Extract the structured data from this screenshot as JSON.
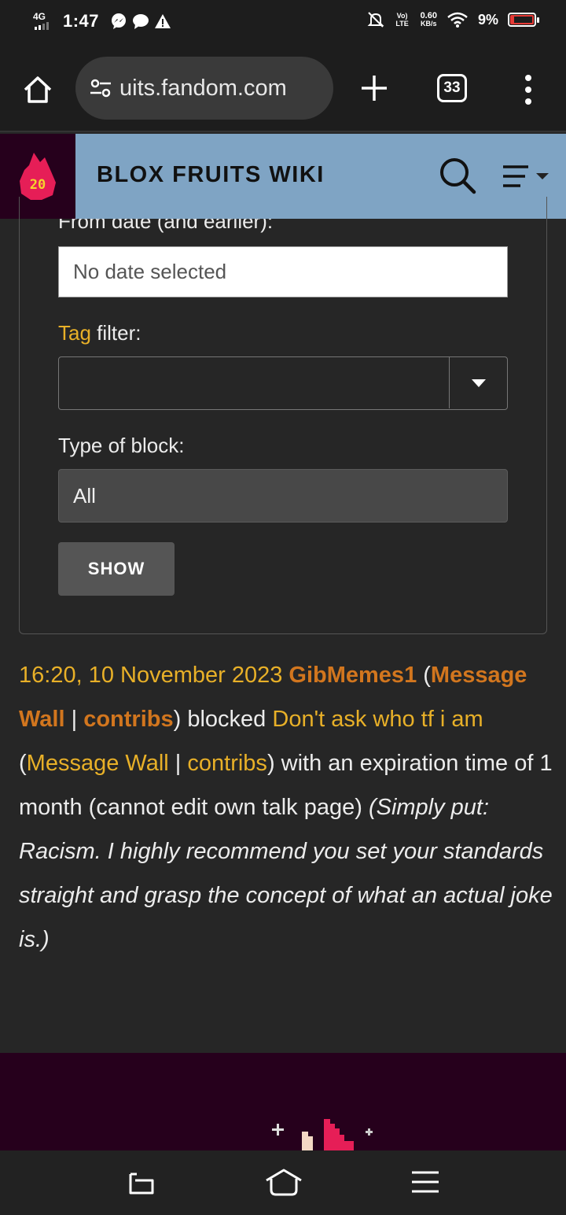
{
  "status_bar": {
    "network": "4G",
    "time": "1:47",
    "volte": "Vo) LTE",
    "speed": "0.60",
    "speed_unit": "KB/s",
    "battery": "9%"
  },
  "browser": {
    "url": "uits.fandom.com",
    "tab_count": "33"
  },
  "wiki": {
    "logo_text": "20",
    "title": "BLOX FRUITS WIKI",
    "accent_color": "#7fa4c4"
  },
  "form": {
    "from_date_label": "From date (and earlier):",
    "date_placeholder": "No date selected",
    "tag_link": "Tag",
    "tag_label_rest": " filter:",
    "tag_value": "",
    "type_label": "Type of block:",
    "type_value": "All",
    "show_button": "SHOW"
  },
  "log_entry": {
    "timestamp": "16:20, 10 November 2023",
    "blocker": "GibMemes1",
    "blocker_wall": "Message Wall",
    "blocker_contribs": "contribs",
    "action": "blocked",
    "target": "Don't ask who tf i am",
    "target_wall": "Message Wall",
    "target_contribs": "contribs",
    "details": "with an expiration time of 1 month (cannot edit own talk page)",
    "reason": "(Simply put: Racism. I highly recommend you set your standards straight and grasp the concept of what an actual joke is.)"
  },
  "colors": {
    "link_gold": "#e8b028",
    "link_orange": "#d2761e",
    "footer_bg": "#26001c"
  }
}
